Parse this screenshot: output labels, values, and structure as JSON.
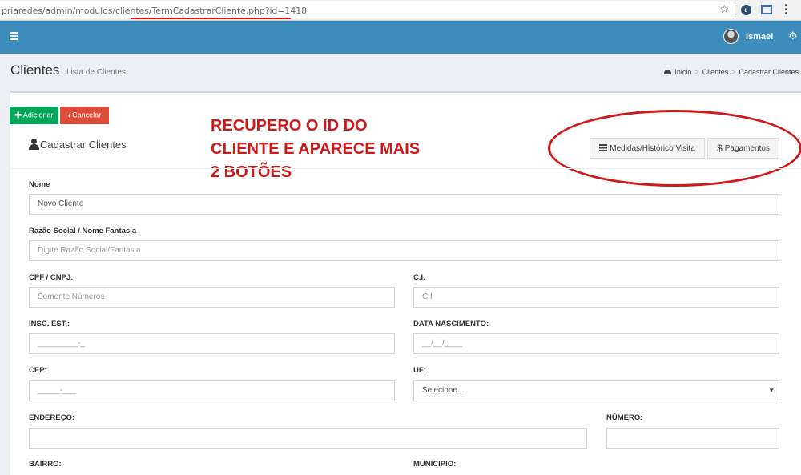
{
  "browser": {
    "url_prefix": "priaredes/admin/modulos/clientes/",
    "url_highlight": "TermCadastrarCliente.php?id=1418"
  },
  "header": {
    "user_name": "Ismael"
  },
  "page": {
    "title": "Clientes",
    "subtitle": "Lista de Clientes",
    "breadcrumb": [
      "Inicio",
      "Clientes",
      "Cadastrar Clientes"
    ]
  },
  "toolbar": {
    "add_label": "Adicionar",
    "cancel_label": "Cancelar"
  },
  "box": {
    "title": "Cadastrar Clientes",
    "medidas_label": "Medidas/Histórico Visita",
    "pagamentos_label": "Pagamentos"
  },
  "annotation": {
    "line1": "RECUPERO O ID DO",
    "line2": "CLIENTE E APARECE MAIS",
    "line3": "2 BOTÕES"
  },
  "form": {
    "nome": {
      "label": "Nome",
      "value": "Novo Cliente"
    },
    "razao": {
      "label": "Razão Social / Nome Fantasia",
      "placeholder": "Digite Razão Social/Fantasia"
    },
    "cpf": {
      "label": "CPF / CNPJ:",
      "placeholder": "Somente Números"
    },
    "ci": {
      "label": "C.I:",
      "placeholder": "C.I"
    },
    "insc": {
      "label": "INSC. EST.:",
      "value": "_________-_"
    },
    "nasc": {
      "label": "DATA NASCIMENTO:",
      "value": "__/__/____"
    },
    "cep": {
      "label": "CEP:",
      "value": "_____-___"
    },
    "uf": {
      "label": "UF:",
      "value": "Selecione..."
    },
    "endereco": {
      "label": "ENDEREÇO:",
      "value": ""
    },
    "numero": {
      "label": "NÚMERO:",
      "value": ""
    },
    "bairro": {
      "label": "BAIRRO:"
    },
    "municipio": {
      "label": "MUNICIPIO:"
    }
  }
}
